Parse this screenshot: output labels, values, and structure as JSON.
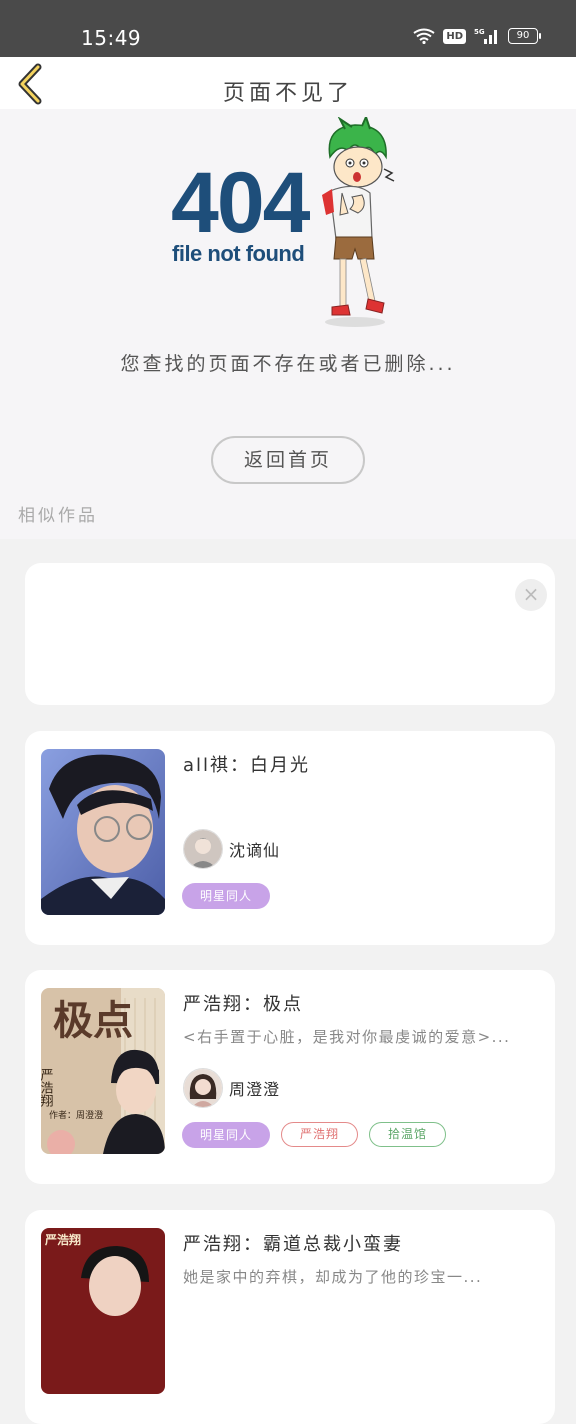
{
  "status_bar": {
    "time": "15:49",
    "network": "5G",
    "hd": "HD",
    "battery": "90"
  },
  "header": {
    "title": "页面不见了"
  },
  "not_found": {
    "code": "404",
    "subtitle": "file not found",
    "message": "您查找的页面不存在或者已删除...",
    "home_button": "返回首页"
  },
  "similar": {
    "label": "相似作品"
  },
  "ad": {
    "close_label": "×"
  },
  "works": [
    {
      "title": "all祺：白月光",
      "desc": "",
      "author": "沈谪仙",
      "tags": [
        {
          "label": "明星同人",
          "style": "purple"
        }
      ]
    },
    {
      "title": "严浩翔：极点",
      "desc": "<右手置于心脏，是我对你最虔诚的爱意>...",
      "author": "周澄澄",
      "cover_text": "极点",
      "cover_side": "严浩翔",
      "cover_author": "作者：周澄澄",
      "tags": [
        {
          "label": "明星同人",
          "style": "purple"
        },
        {
          "label": "严浩翔",
          "style": "red"
        },
        {
          "label": "拾温馆",
          "style": "green"
        }
      ]
    },
    {
      "title": "严浩翔：霸道总裁小蛮妻",
      "desc": "她是家中的弃棋，却成为了他的珍宝一...",
      "author": "",
      "cover_side": "严浩翔",
      "tags": []
    }
  ]
}
